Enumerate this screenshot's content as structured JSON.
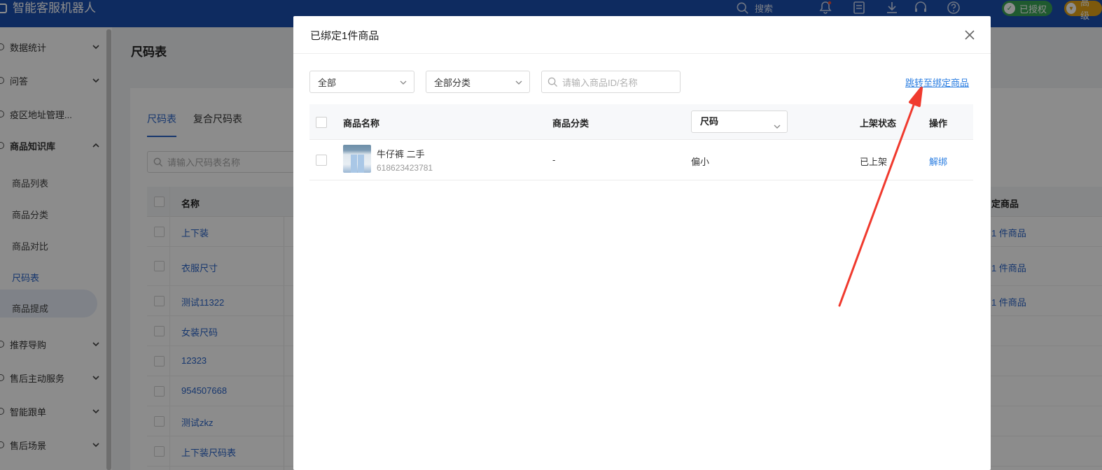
{
  "topbar": {
    "app_title": "智能客服机器人",
    "search_label": "搜索",
    "icons": [
      "bell-icon",
      "list-icon",
      "download-icon",
      "headset-icon",
      "help-icon"
    ],
    "authorized_badge": "已授权",
    "advanced_badge": "高级"
  },
  "sidebar": {
    "menus": [
      {
        "label": "数据统计"
      },
      {
        "label": "问答"
      },
      {
        "label": "疫区地址管理..."
      },
      {
        "label": "商品知识库"
      },
      {
        "label": "推荐导购"
      },
      {
        "label": "售后主动服务"
      },
      {
        "label": "智能跟单"
      },
      {
        "label": "售后场景"
      }
    ],
    "submenu": [
      "商品列表",
      "商品分类",
      "商品对比",
      "尺码表",
      "商品提成"
    ],
    "active_submenu": "尺码表"
  },
  "page": {
    "title": "尺码表",
    "tabs": [
      "尺码表",
      "复合尺码表"
    ],
    "search_placeholder": "请输入尺码表名称",
    "table_header_name": "名称",
    "table_header_bound": "定商品",
    "rows": [
      {
        "name": "上下装",
        "bound": "1 件商品"
      },
      {
        "name": "衣服尺寸",
        "bound": "1 件商品"
      },
      {
        "name": "测试11322",
        "bound": "1 件商品"
      },
      {
        "name": "女装尺码",
        "bound": ""
      },
      {
        "name": "12323",
        "bound": ""
      },
      {
        "name": "954507668",
        "bound": ""
      },
      {
        "name": "测试zkz",
        "bound": ""
      },
      {
        "name": "上下装尺码表",
        "bound": ""
      }
    ]
  },
  "modal": {
    "title": "已绑定1件商品",
    "filter_status": "全部",
    "filter_category": "全部分类",
    "search_placeholder": "请输入商品ID/名称",
    "jump_link": "跳转至绑定商品",
    "columns": {
      "name": "商品名称",
      "category": "商品分类",
      "size": "尺码",
      "status": "上架状态",
      "action": "操作"
    },
    "rows": [
      {
        "name": "牛仔裤 二手",
        "id": "618623423781",
        "category": "-",
        "size": "偏小",
        "status": "已上架",
        "action": "解绑"
      }
    ]
  },
  "colors": {
    "topbar": "#1b4fb0",
    "link": "#2a7de1",
    "annotation_arrow": "#f03a2e"
  }
}
